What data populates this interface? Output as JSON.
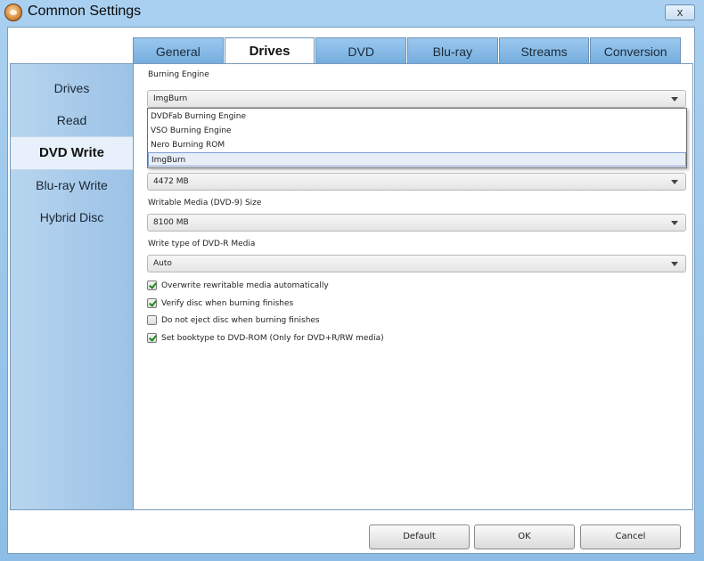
{
  "window": {
    "title": "Common Settings",
    "close_label": "x"
  },
  "tabs": [
    {
      "label": "General"
    },
    {
      "label": "Drives"
    },
    {
      "label": "DVD"
    },
    {
      "label": "Blu-ray"
    },
    {
      "label": "Streams"
    },
    {
      "label": "Conversion"
    }
  ],
  "active_tab": "Drives",
  "sidebar": {
    "items": [
      {
        "label": "Drives"
      },
      {
        "label": "Read"
      },
      {
        "label": "DVD Write"
      },
      {
        "label": "Blu-ray Write"
      },
      {
        "label": "Hybrid Disc"
      }
    ],
    "active": "DVD Write"
  },
  "fields": {
    "burning_engine": {
      "label": "Burning Engine",
      "value": "ImgBurn",
      "options": [
        "DVDFab Burning Engine",
        "VSO Burning Engine",
        "Nero Burning ROM",
        "ImgBurn"
      ]
    },
    "dvd5_size": {
      "value": "4472 MB"
    },
    "dvd9_size": {
      "label": "Writable Media (DVD-9) Size",
      "value": "8100 MB"
    },
    "write_type": {
      "label": "Write type of DVD-R Media",
      "value": "Auto"
    }
  },
  "checkboxes": [
    {
      "label": "Overwrite rewritable media automatically",
      "checked": true
    },
    {
      "label": "Verify disc when burning finishes",
      "checked": true
    },
    {
      "label": "Do not eject disc when burning finishes",
      "checked": false
    },
    {
      "label": "Set booktype to DVD-ROM (Only for DVD+R/RW media)",
      "checked": true
    }
  ],
  "buttons": {
    "default": "Default",
    "ok": "OK",
    "cancel": "Cancel"
  }
}
